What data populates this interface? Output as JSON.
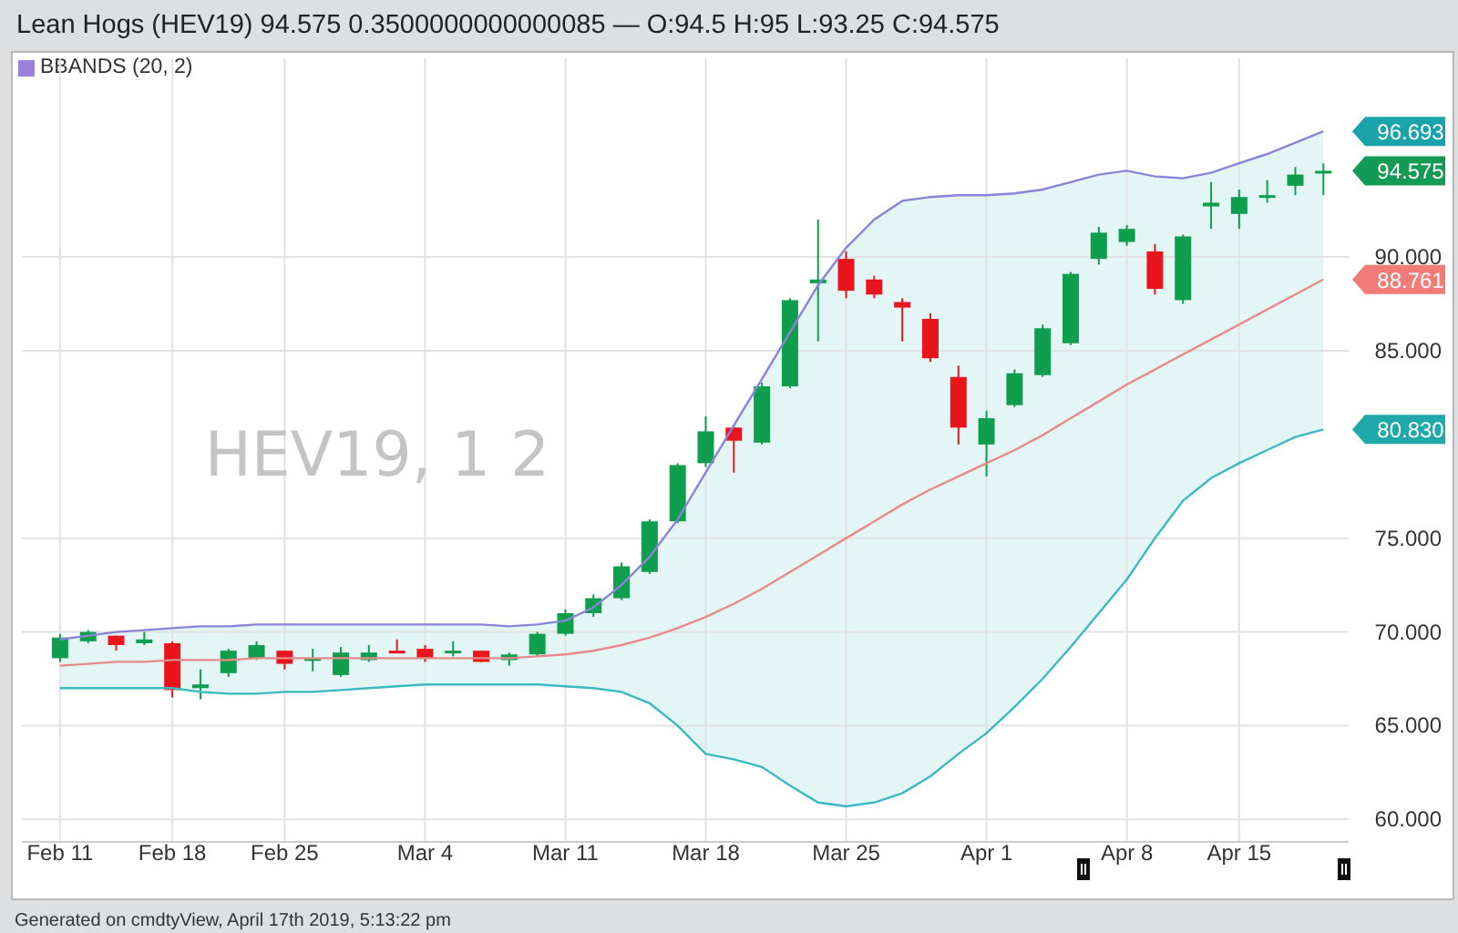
{
  "header": {
    "title": "Lean Hogs (HEV19) 94.575 0.3500000000000085 — O:94.5 H:95 L:93.25 C:94.575"
  },
  "legend": {
    "label": "BBANDS (20, 2)",
    "color": "#9b7fd8"
  },
  "chart": {
    "watermark": "HEV19, 1 2",
    "chart_data": {
      "type": "candlestick",
      "categories": [
        "Feb 11",
        null,
        null,
        null,
        "Feb 18",
        null,
        null,
        null,
        "Feb 25",
        null,
        null,
        null,
        null,
        "Mar 4",
        null,
        null,
        null,
        null,
        "Mar 11",
        null,
        null,
        null,
        null,
        "Mar 18",
        null,
        null,
        null,
        null,
        "Mar 25",
        null,
        null,
        null,
        null,
        "Apr 1",
        null,
        null,
        null,
        null,
        "Apr 8",
        null,
        null,
        null,
        "Apr 15",
        null,
        null,
        null
      ],
      "ylim": [
        58.8,
        100.6
      ],
      "grid": true,
      "yticks": [
        {
          "value": 60,
          "label": "60.000"
        },
        {
          "value": 65,
          "label": "65.000"
        },
        {
          "value": 70,
          "label": "70.000"
        },
        {
          "value": 75,
          "label": "75.000"
        },
        {
          "value": 85,
          "label": "85.000"
        },
        {
          "value": 90,
          "label": "90.000"
        }
      ],
      "ohlc": [
        [
          68.6,
          69.9,
          68.4,
          69.7
        ],
        [
          69.5,
          70.1,
          69.4,
          70.0
        ],
        [
          69.8,
          69.8,
          69.0,
          69.3
        ],
        [
          69.4,
          70.0,
          69.3,
          69.6
        ],
        [
          69.4,
          69.5,
          66.5,
          66.9
        ],
        [
          67.0,
          68.0,
          66.4,
          67.2
        ],
        [
          67.8,
          69.1,
          67.6,
          69.0
        ],
        [
          68.6,
          69.5,
          68.5,
          69.3
        ],
        [
          69.0,
          69.0,
          68.0,
          68.3
        ],
        [
          68.5,
          69.1,
          67.9,
          68.6
        ],
        [
          67.7,
          69.2,
          67.6,
          68.9
        ],
        [
          68.5,
          69.3,
          68.4,
          68.9
        ],
        [
          69.0,
          69.6,
          68.9,
          68.9
        ],
        [
          69.1,
          69.3,
          68.4,
          68.6
        ],
        [
          68.9,
          69.5,
          68.7,
          69.0
        ],
        [
          69.0,
          69.0,
          68.4,
          68.4
        ],
        [
          68.5,
          68.9,
          68.2,
          68.8
        ],
        [
          68.8,
          70.0,
          68.7,
          69.9
        ],
        [
          69.9,
          71.2,
          69.8,
          71.0
        ],
        [
          71.0,
          72.0,
          70.8,
          71.8
        ],
        [
          71.8,
          73.7,
          71.7,
          73.5
        ],
        [
          73.2,
          76.0,
          73.1,
          75.9
        ],
        [
          75.9,
          79.0,
          75.8,
          78.9
        ],
        [
          79.0,
          81.5,
          78.8,
          80.7
        ],
        [
          80.9,
          81.0,
          78.5,
          80.2
        ],
        [
          80.1,
          83.3,
          80.0,
          83.1
        ],
        [
          83.1,
          87.8,
          83.0,
          87.7
        ],
        [
          88.6,
          92.0,
          85.5,
          88.8
        ],
        [
          89.9,
          90.3,
          87.8,
          88.2
        ],
        [
          88.8,
          89.0,
          87.8,
          88.0
        ],
        [
          87.6,
          87.8,
          85.5,
          87.3
        ],
        [
          86.7,
          87.0,
          84.4,
          84.6
        ],
        [
          83.6,
          84.2,
          80.0,
          80.9
        ],
        [
          80.0,
          81.8,
          78.3,
          81.4
        ],
        [
          82.1,
          84.0,
          82.0,
          83.8
        ],
        [
          83.7,
          86.4,
          83.6,
          86.2
        ],
        [
          85.4,
          89.2,
          85.3,
          89.1
        ],
        [
          89.9,
          91.6,
          89.6,
          91.3
        ],
        [
          90.8,
          91.7,
          90.6,
          91.5
        ],
        [
          90.3,
          90.7,
          88.0,
          88.3
        ],
        [
          87.7,
          91.2,
          87.5,
          91.1
        ],
        [
          92.7,
          94.0,
          91.5,
          92.9
        ],
        [
          92.3,
          93.6,
          91.5,
          93.2
        ],
        [
          93.2,
          94.1,
          92.9,
          93.3
        ],
        [
          93.8,
          94.8,
          93.3,
          94.4
        ],
        [
          94.5,
          95.0,
          93.3,
          94.6
        ]
      ],
      "series": [
        {
          "type": "line",
          "color": "#8a84d6",
          "values": [
            69.6,
            69.8,
            70.0,
            70.1,
            70.2,
            70.3,
            70.3,
            70.4,
            70.4,
            70.4,
            70.4,
            70.4,
            70.4,
            70.4,
            70.4,
            70.4,
            70.3,
            70.4,
            70.6,
            71.3,
            72.5,
            74.0,
            76.0,
            78.5,
            81.0,
            83.5,
            86.0,
            88.5,
            90.5,
            92.0,
            93.0,
            93.2,
            93.3,
            93.3,
            93.4,
            93.6,
            94.0,
            94.4,
            94.6,
            94.3,
            94.2,
            94.5,
            95.0,
            95.5,
            96.1,
            96.7
          ]
        },
        {
          "type": "line",
          "color": "#e88a8a",
          "values": [
            68.2,
            68.3,
            68.4,
            68.4,
            68.5,
            68.5,
            68.5,
            68.6,
            68.6,
            68.6,
            68.6,
            68.6,
            68.6,
            68.6,
            68.6,
            68.6,
            68.6,
            68.7,
            68.8,
            69.0,
            69.3,
            69.7,
            70.2,
            70.8,
            71.5,
            72.3,
            73.2,
            74.1,
            75.0,
            75.9,
            76.8,
            77.6,
            78.3,
            79.0,
            79.7,
            80.5,
            81.4,
            82.3,
            83.2,
            84.0,
            84.8,
            85.6,
            86.4,
            87.2,
            88.0,
            88.8
          ]
        },
        {
          "type": "line",
          "color": "#3bb9c0",
          "values": [
            67.0,
            67.0,
            67.0,
            67.0,
            67.0,
            66.8,
            66.7,
            66.7,
            66.8,
            66.8,
            66.9,
            67.0,
            67.1,
            67.2,
            67.2,
            67.2,
            67.2,
            67.2,
            67.1,
            67.0,
            66.8,
            66.2,
            65.0,
            63.5,
            63.2,
            62.8,
            61.8,
            60.9,
            60.7,
            60.9,
            61.4,
            62.3,
            63.5,
            64.6,
            66.0,
            67.5,
            69.2,
            71.0,
            72.8,
            75.0,
            77.0,
            78.2,
            79.0,
            79.7,
            80.4,
            80.8
          ]
        }
      ],
      "annotations": [
        "96.693",
        "94.575",
        "88.761",
        "80.830"
      ]
    }
  },
  "footer": {
    "text": "Generated on cmdtyView, April 17th 2019, 5:13:22 pm"
  }
}
